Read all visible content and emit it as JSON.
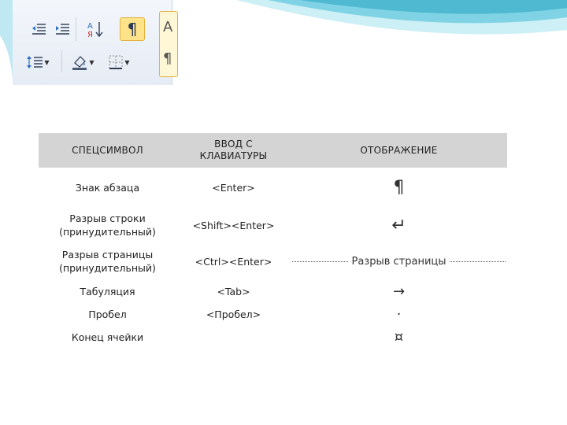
{
  "ribbon": {
    "icons": [
      "decrease-indent-icon",
      "increase-indent-icon",
      "sort-icon",
      "show-formatting-marks-icon",
      "line-spacing-icon",
      "shading-icon",
      "borders-icon"
    ],
    "pilcrow_glyph": "¶",
    "style_letter": "A",
    "style_mark": "¶"
  },
  "table": {
    "headers": {
      "col1": "СПЕЦСИМВОЛ",
      "col2_line1": "ВВОД С",
      "col2_line2": "КЛАВИАТУРЫ",
      "col3": "ОТОБРАЖЕНИЕ"
    },
    "rows": [
      {
        "name": "Знак абзаца",
        "name2": "",
        "input": "<Enter>",
        "display": "¶"
      },
      {
        "name": "Разрыв строки",
        "name2": "(принудительный)",
        "input": "<Shift><Enter>",
        "display": "↵"
      },
      {
        "name": "Разрыв страницы",
        "name2": "(принудительный)",
        "input": "<Ctrl><Enter>",
        "display": "Разрыв страницы"
      },
      {
        "name": "Табуляция",
        "name2": "",
        "input": "<Tab>",
        "display": "→"
      },
      {
        "name": "Пробел",
        "name2": "",
        "input": "<Пробел>",
        "display": "·"
      },
      {
        "name": "Конец ячейки",
        "name2": "",
        "input": "",
        "display": "¤"
      }
    ]
  },
  "colors": {
    "header_bg": "#d4d4d4",
    "wave": "#5bc2d8",
    "highlight": "#ffe38a"
  }
}
